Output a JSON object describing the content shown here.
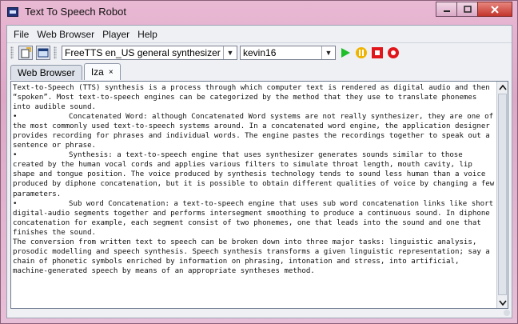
{
  "window": {
    "title": "Text To Speech Robot"
  },
  "menu": {
    "items": [
      "File",
      "Web Browser",
      "Player",
      "Help"
    ]
  },
  "toolbar": {
    "synthesizer": "FreeTTS en_US general synthesizer",
    "voice": "kevin16"
  },
  "tabs": [
    {
      "label": "Web Browser"
    },
    {
      "label": "Iza",
      "close": "×"
    }
  ],
  "content": {
    "p1": "Text-to-Speech (TTS) synthesis is a process through which computer text is rendered as digital audio and then “spoken”. Most text-to-speech engines can be categorized by the method that they use to translate phonemes into audible sound.",
    "b1": "Concatenated Word: although Concatenated Word systems are not really synthesizer, they are one of the most commonly used text-to-speech systems around. In a concatenated word engine, the application designer provides recording for phrases and individual words. The engine pastes the recordings together to speak out a sentence or phrase.",
    "b2": "Synthesis: a text-to-speech engine that uses synthesizer generates sounds similar to those created by the human vocal cords and applies various filters to simulate throat length, mouth cavity, lip shape and tongue position. The voice produced by synthesis technology tends to sound less human than a voice produced by diphone concatenation, but it is possible to obtain different qualities of voice by changing a few parameters.",
    "b3": "Sub word Concatenation: a text-to-speech engine that uses sub word concatenation links like short digital-audio segments together and performs intersegment smoothing to produce a continuous sound. In diphone concatenation for example, each segment consist of two phonemes, one that leads into the sound and one that finishes the sound.",
    "p2": "The conversion from written text to speech can be broken down into three major tasks: linguistic analysis, prosodic modelling and speech synthesis. Speech synthesis transforms a given linguistic representation; say a chain of phonetic symbols enriched by information on phrasing, intonation and stress, into artificial, machine-generated speech by means of an appropriate syntheses method.",
    "bullet": "•"
  },
  "colors": {
    "play": "#1fbf2a",
    "pause": "#f0b400",
    "stop": "#e0161b",
    "record": "#e0161b"
  }
}
